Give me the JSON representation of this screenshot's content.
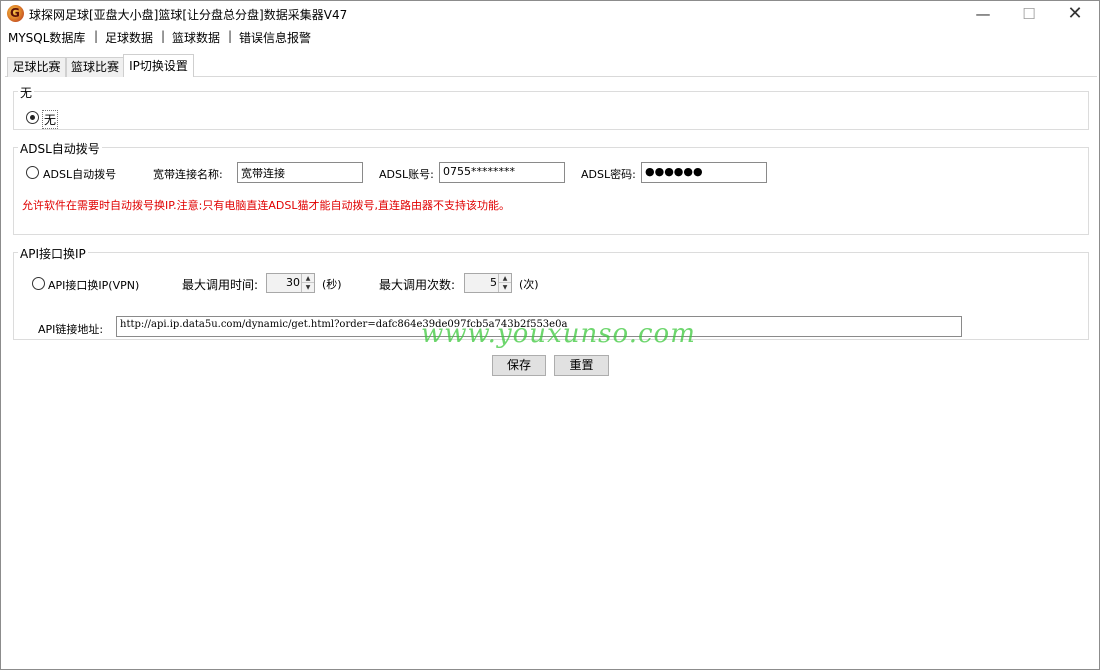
{
  "window": {
    "title": "球探网足球[亚盘大小盘]篮球[让分盘总分盘]数据采集器V47",
    "icon": "app-logo-icon"
  },
  "menu": [
    "MYSQL数据库",
    "足球数据",
    "篮球数据",
    "错误信息报警"
  ],
  "menu_separator": "|",
  "tabs": [
    {
      "label": "足球比赛",
      "active": false
    },
    {
      "label": "篮球比赛",
      "active": false
    },
    {
      "label": "IP切换设置",
      "active": true
    }
  ],
  "group_none": {
    "title": "无",
    "radio_label": "无",
    "checked": true
  },
  "group_adsl": {
    "title": "ADSL自动拨号",
    "radio_label": "ADSL自动拨号",
    "checked": false,
    "conn_name_label": "宽带连接名称:",
    "conn_name_value": "宽带连接",
    "account_label": "ADSL账号:",
    "account_value": "0755********",
    "password_label": "ADSL密码:",
    "password_value": "●●●●●●",
    "warning": "允许软件在需要时自动拨号换IP.注意:只有电脑直连ADSL猫才能自动拨号,直连路由器不支持该功能。",
    "warning_color": "#e00000"
  },
  "group_api": {
    "title": "API接口换IP",
    "radio_label": "API接口换IP(VPN)",
    "checked": false,
    "max_time_label": "最大调用时间:",
    "max_time_value": "30",
    "max_time_unit": "(秒)",
    "max_count_label": "最大调用次数:",
    "max_count_value": "5",
    "max_count_unit": "(次)",
    "url_label": "API链接地址:",
    "url_value": "http://api.ip.data5u.com/dynamic/get.html?order=dafc864e39de097fcb5a743b2f553e0a"
  },
  "buttons": {
    "save": "保存",
    "reset": "重置"
  },
  "watermark": "www.youxunso.com",
  "colors": {
    "watermark": "#3cc83c",
    "warning": "#e00000"
  }
}
